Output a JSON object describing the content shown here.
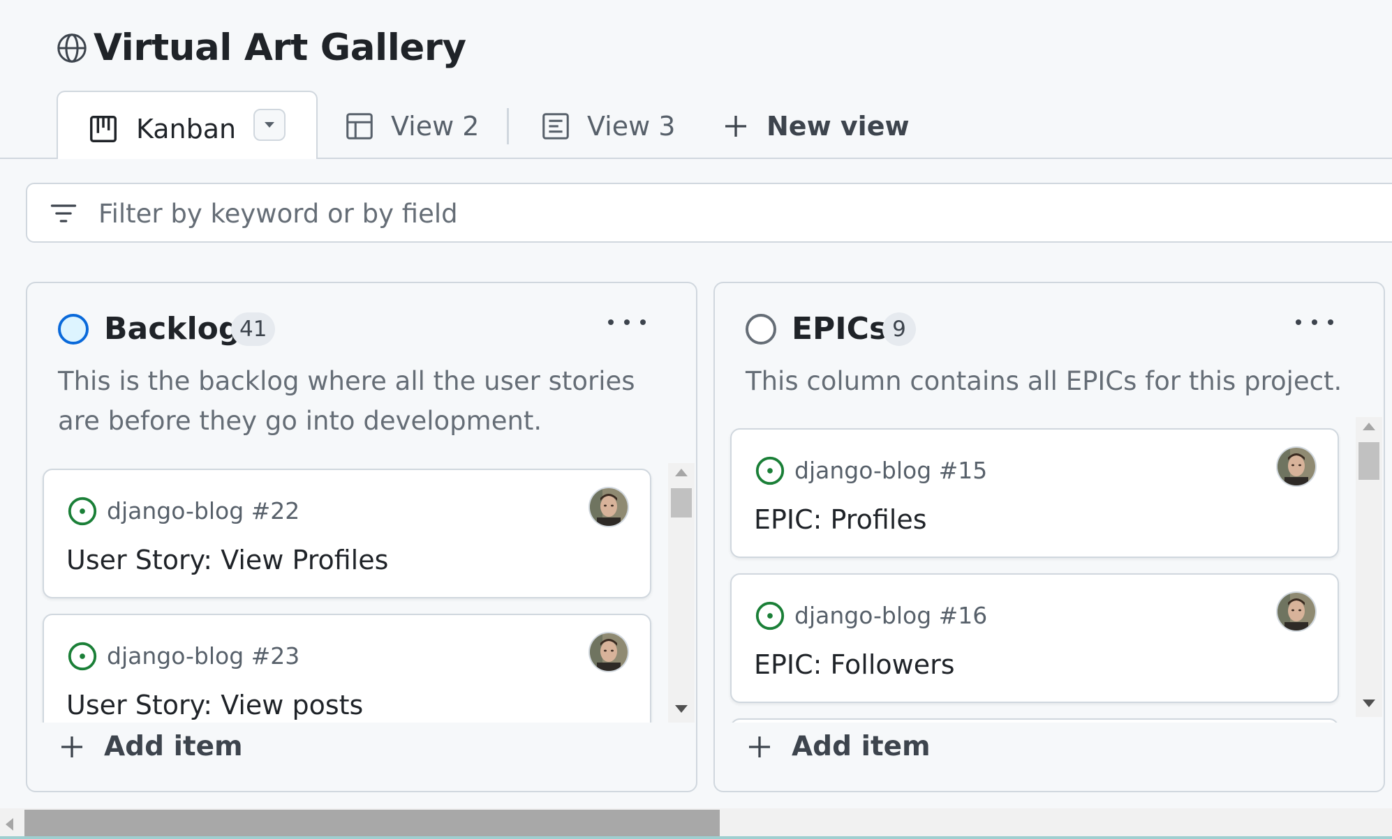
{
  "project": {
    "title": "Virtual Art Gallery",
    "icon": "globe-icon"
  },
  "tabs": [
    {
      "label": "Kanban",
      "icon": "board-icon",
      "active": true
    },
    {
      "label": "View 2",
      "icon": "table-icon",
      "active": false
    },
    {
      "label": "View 3",
      "icon": "list-view-icon",
      "active": false
    }
  ],
  "new_view_label": "New view",
  "filter": {
    "placeholder": "Filter by keyword or by field",
    "value": ""
  },
  "columns": [
    {
      "name": "Backlog",
      "count": "41",
      "status_color": "#0969da",
      "status_fill": "#ddf4ff",
      "description": "This is the backlog where all the user stories are before they go into development.",
      "add_label": "Add item",
      "cards": [
        {
          "ref": "django-blog #22",
          "title": "User Story: View Profiles"
        },
        {
          "ref": "django-blog #23",
          "title": "User Story: View posts"
        }
      ]
    },
    {
      "name": "EPICs",
      "count": "9",
      "status_color": "#656d76",
      "status_fill": "#ffffff",
      "description": "This column contains all EPICs for this project.",
      "add_label": "Add item",
      "cards": [
        {
          "ref": "django-blog #15",
          "title": "EPIC: Profiles"
        },
        {
          "ref": "django-blog #16",
          "title": "EPIC: Followers"
        }
      ]
    }
  ],
  "colors": {
    "open_issue": "#1a7f37",
    "border": "#d0d7de",
    "muted_text": "#656d76"
  }
}
